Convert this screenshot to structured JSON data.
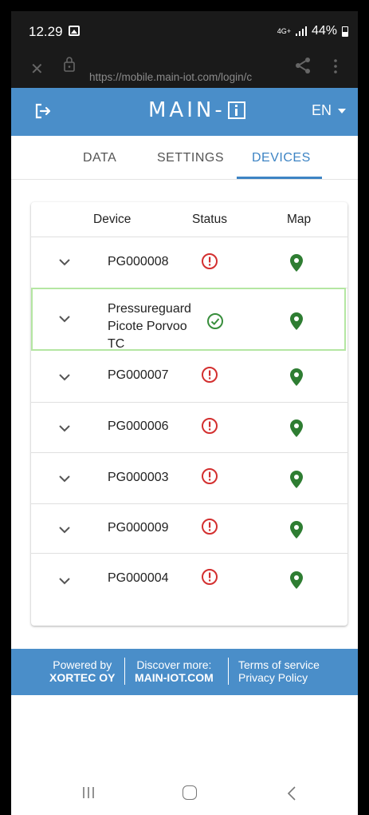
{
  "status_bar": {
    "time": "12.29",
    "network": "4G+",
    "battery": "44%"
  },
  "browser": {
    "url": "https://mobile.main-iot.com/login/c"
  },
  "header": {
    "brand": "MAIN-",
    "language": "EN"
  },
  "tabs": [
    {
      "label": "DATA",
      "active": false
    },
    {
      "label": "SETTINGS",
      "active": false
    },
    {
      "label": "DEVICES",
      "active": true
    }
  ],
  "table": {
    "headers": {
      "device": "Device",
      "status": "Status",
      "map": "Map"
    },
    "rows": [
      {
        "name": "PG000008",
        "status": "error"
      },
      {
        "name_lines": [
          "Pressureguard",
          "Picote Porvoo",
          "TC"
        ],
        "status": "ok"
      },
      {
        "name": "PG000007",
        "status": "error"
      },
      {
        "name": "PG000006",
        "status": "error"
      },
      {
        "name": "PG000003",
        "status": "error"
      },
      {
        "name": "PG000009",
        "status": "error"
      },
      {
        "name": "PG000004",
        "status": "error"
      }
    ]
  },
  "footer": {
    "powered_by": "Powered by",
    "company": "XORTEC OY",
    "discover": "Discover more:",
    "site": "MAIN-IOT.COM",
    "terms": "Terms of service",
    "privacy": "Privacy Policy"
  },
  "colors": {
    "accent": "#4a8ec9",
    "tab_active": "#3d84c4",
    "error": "#d32f2f",
    "ok": "#388e3c",
    "map_pin": "#2e7d32",
    "selected_border": "#b4e6a2"
  }
}
